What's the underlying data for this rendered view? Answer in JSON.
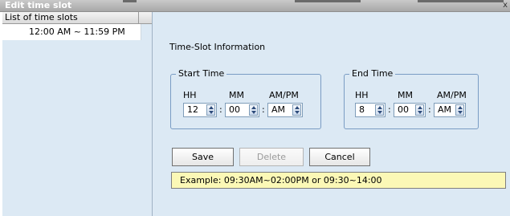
{
  "window": {
    "title": "Edit time slot",
    "close_label": "x"
  },
  "left_panel": {
    "header": "List of time slots",
    "items": [
      {
        "label": "12:00 AM ~ 11:59 PM"
      }
    ]
  },
  "main": {
    "section_title": "Time-Slot Information",
    "start_time": {
      "legend": "Start Time",
      "hh_label": "HH",
      "mm_label": "MM",
      "ampm_label": "AM/PM",
      "hh_value": "12",
      "mm_value": "00",
      "ampm_value": "AM"
    },
    "end_time": {
      "legend": "End Time",
      "hh_label": "HH",
      "mm_label": "MM",
      "ampm_label": "AM/PM",
      "hh_value": "8",
      "mm_value": "00",
      "ampm_value": "AM"
    },
    "separator": ":",
    "buttons": {
      "save": "Save",
      "delete": "Delete",
      "cancel": "Cancel"
    },
    "example": "Example: 09:30AM~02:00PM or 09:30~14:00"
  },
  "colors": {
    "panel_bg": "#dce9f4",
    "example_bg": "#fbf8b6",
    "group_border": "#7a9cc4"
  }
}
